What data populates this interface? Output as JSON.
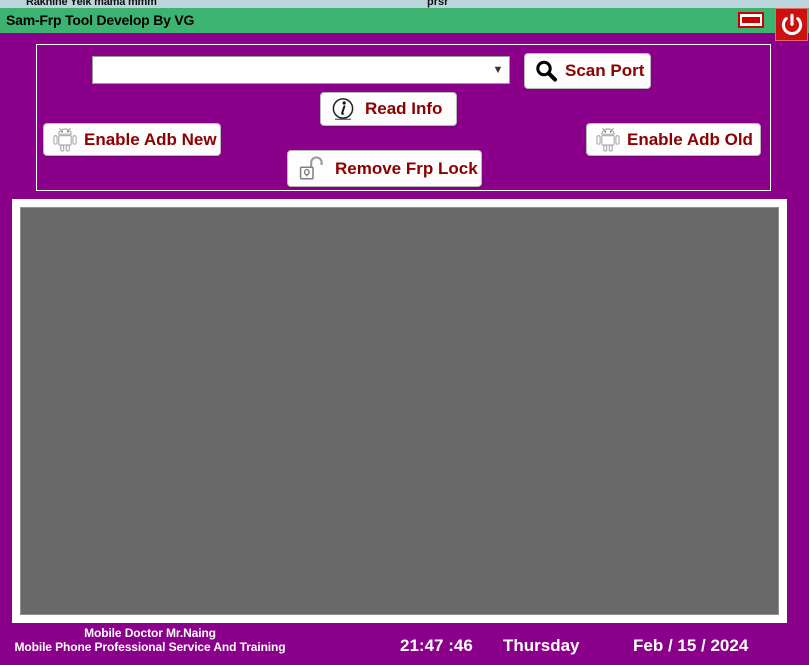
{
  "background_window": {
    "title_left": "Rakhine Yeik mama mmm",
    "title_right": "prsr"
  },
  "titlebar": {
    "title": "Sam-Frp Tool Develop By VG",
    "minimize_label": "Minimize",
    "close_label": "Power Off",
    "bg_color": "#3CB371",
    "close_color": "#CC1111",
    "minimize_color": "#CC0000"
  },
  "theme": {
    "window_background": "#8B008B",
    "button_text": "#8B0000",
    "log_background": "#696969",
    "status_text": "#FFFFFF"
  },
  "toolbar": {
    "port_combo": {
      "value": "",
      "placeholder": "",
      "icon": "chevron-down-icon"
    },
    "buttons": [
      {
        "id": "scan_port",
        "label": "Scan Port",
        "icon": "magnifier-icon"
      },
      {
        "id": "read_info",
        "label": "Read Info",
        "icon": "info-circle-icon"
      },
      {
        "id": "enable_adb_new",
        "label": "Enable Adb New",
        "icon": "android-robot-icon"
      },
      {
        "id": "enable_adb_old",
        "label": "Enable Adb Old",
        "icon": "android-robot-icon"
      },
      {
        "id": "remove_frp",
        "label": "Remove Frp Lock",
        "icon": "open-padlock-icon"
      }
    ]
  },
  "log": {
    "content": ""
  },
  "statusbar": {
    "credit_line1": "Mobile Doctor Mr.Naing",
    "credit_line2": "Mobile Phone Professional Service And Training",
    "time": "21:47 :46",
    "weekday": "Thursday",
    "date": "Feb / 15 / 2024"
  }
}
